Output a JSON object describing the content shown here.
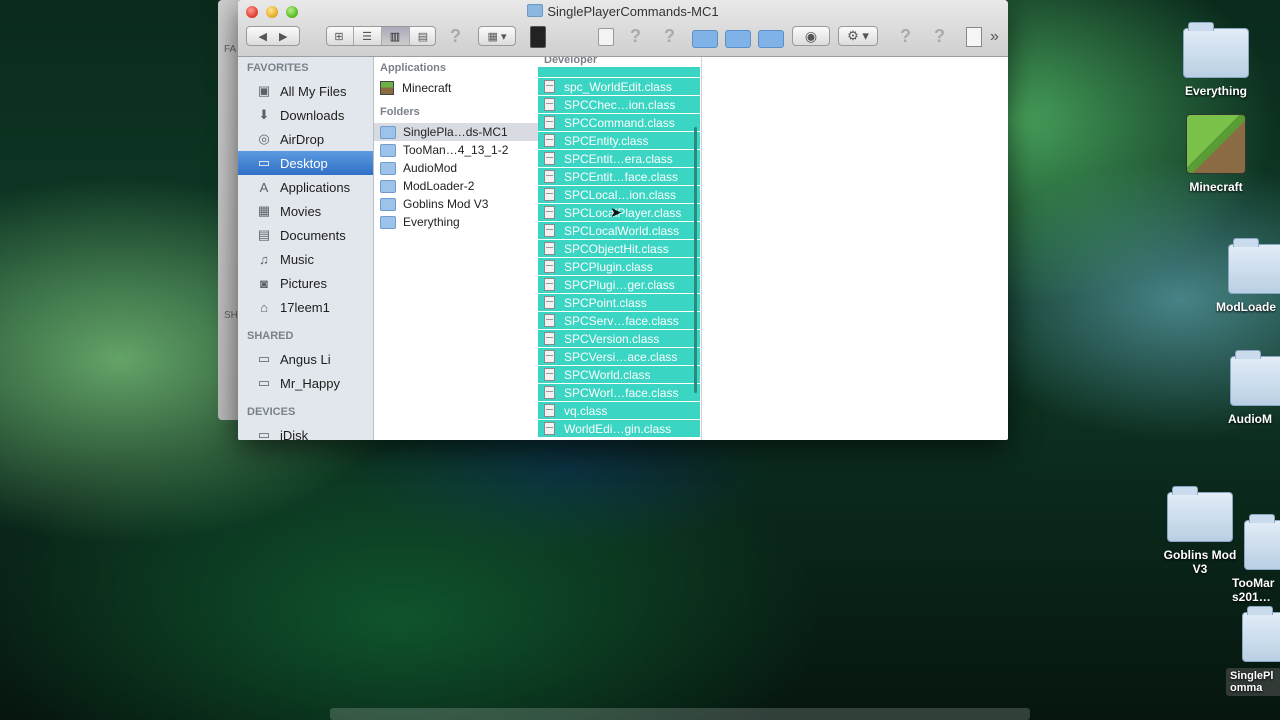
{
  "window": {
    "title": "SinglePlayerCommands-MC1"
  },
  "toolbar": {
    "back_icon": "back-arrow-icon",
    "forward_icon": "forward-arrow-icon",
    "view_icons": [
      "icon-view-icon",
      "list-view-icon",
      "column-view-icon",
      "coverflow-view-icon"
    ],
    "overflow": "»"
  },
  "sidebar": {
    "favorites_header": "FAVORITES",
    "favorites": [
      {
        "label": "All My Files",
        "icon": "all-files-icon"
      },
      {
        "label": "Downloads",
        "icon": "downloads-icon"
      },
      {
        "label": "AirDrop",
        "icon": "airdrop-icon"
      },
      {
        "label": "Desktop",
        "icon": "desktop-icon",
        "selected": true
      },
      {
        "label": "Applications",
        "icon": "applications-icon"
      },
      {
        "label": "Movies",
        "icon": "movies-icon"
      },
      {
        "label": "Documents",
        "icon": "documents-icon"
      },
      {
        "label": "Music",
        "icon": "music-icon"
      },
      {
        "label": "Pictures",
        "icon": "pictures-icon"
      },
      {
        "label": "17leem1",
        "icon": "home-icon"
      }
    ],
    "shared_header": "SHARED",
    "shared": [
      {
        "label": "Angus Li",
        "icon": "computer-icon"
      },
      {
        "label": "Mr_Happy",
        "icon": "computer-icon"
      }
    ],
    "devices_header": "DEVICES",
    "devices": [
      {
        "label": "iDisk",
        "icon": "idisk-icon"
      }
    ]
  },
  "column1": {
    "applications_header": "Applications",
    "applications": [
      "Minecraft"
    ],
    "folders_header": "Folders",
    "folders": [
      {
        "label": "SinglePla…ds-MC1",
        "selected": true
      },
      {
        "label": "TooMan…4_13_1-2"
      },
      {
        "label": "AudioMod"
      },
      {
        "label": "ModLoader-2"
      },
      {
        "label": "Goblins Mod V3"
      },
      {
        "label": "Everything"
      }
    ]
  },
  "column2": {
    "header": "Developer",
    "files": [
      "spc_WorldEdit.class",
      "SPCChec…ion.class",
      "SPCCommand.class",
      "SPCEntity.class",
      "SPCEntit…era.class",
      "SPCEntit…face.class",
      "SPCLocal…ion.class",
      "SPCLocalPlayer.class",
      "SPCLocalWorld.class",
      "SPCObjectHit.class",
      "SPCPlugin.class",
      "SPCPlugi…ger.class",
      "SPCPoint.class",
      "SPCServ…face.class",
      "SPCVersion.class",
      "SPCVersi…ace.class",
      "SPCWorld.class",
      "SPCWorl…face.class",
      "vq.class",
      "WorldEdi…gin.class"
    ]
  },
  "desktop": {
    "items": [
      "Everything",
      "Minecraft",
      "ModLoade",
      "AudioM",
      "Goblins Mod V3",
      "TooMar s201…",
      "SinglePl omma"
    ]
  }
}
